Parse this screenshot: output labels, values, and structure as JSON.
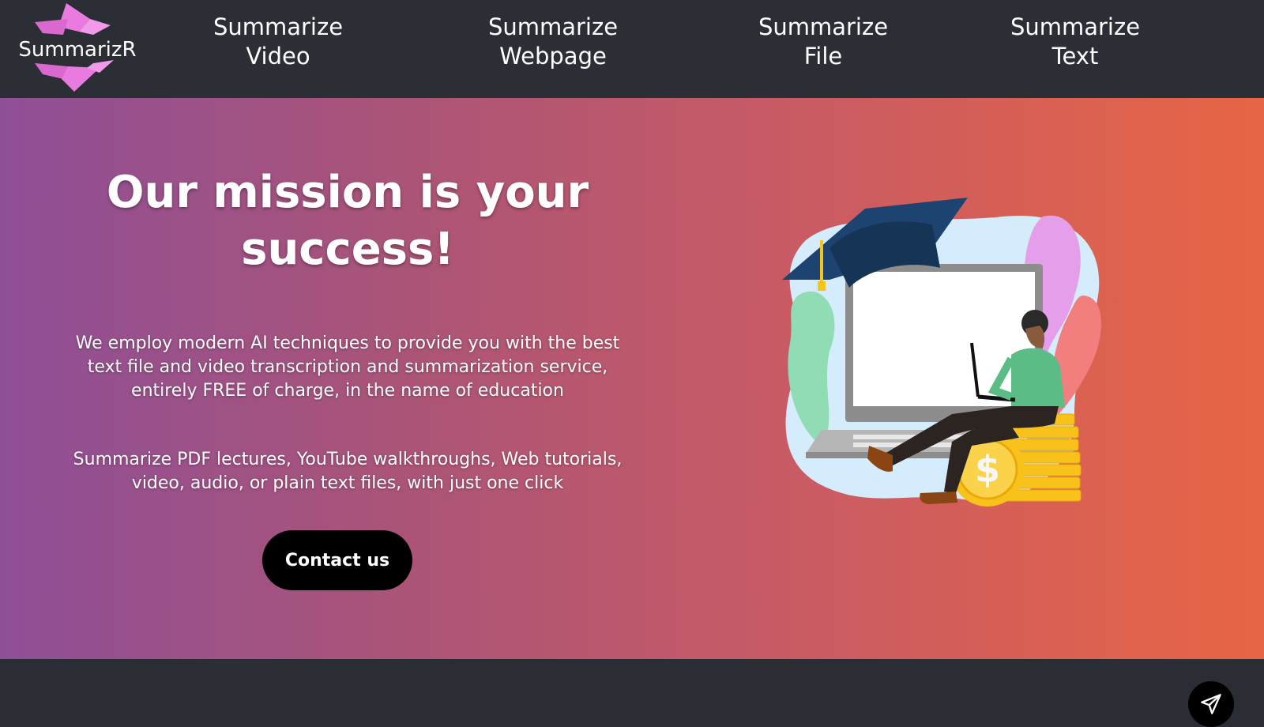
{
  "brand": {
    "name": "SummarizR",
    "color": "#e97be0"
  },
  "nav": [
    {
      "line1": "Summarize",
      "line2": "Video"
    },
    {
      "line1": "Summarize",
      "line2": "Webpage"
    },
    {
      "line1": "Summarize",
      "line2": "File"
    },
    {
      "line1": "Summarize",
      "line2": "Text"
    }
  ],
  "hero": {
    "headline": "Our mission is your success!",
    "paragraph1": "We employ modern AI techniques to provide you with the best text file and video transcription and summarization service, entirely FREE of charge, in the name of education",
    "paragraph2": "Summarize PDF lectures, YouTube walkthroughs, Web tutorials, video, audio, or plain text files, with just one click",
    "cta_label": "Contact us"
  },
  "icons": {
    "illustration": "student-laptop-graduation-illustration",
    "fab": "paper-plane-icon"
  },
  "colors": {
    "topbar": "#2b2e34",
    "gradient_start": "#8f4f97",
    "gradient_end": "#e76545",
    "button": "#000000"
  }
}
